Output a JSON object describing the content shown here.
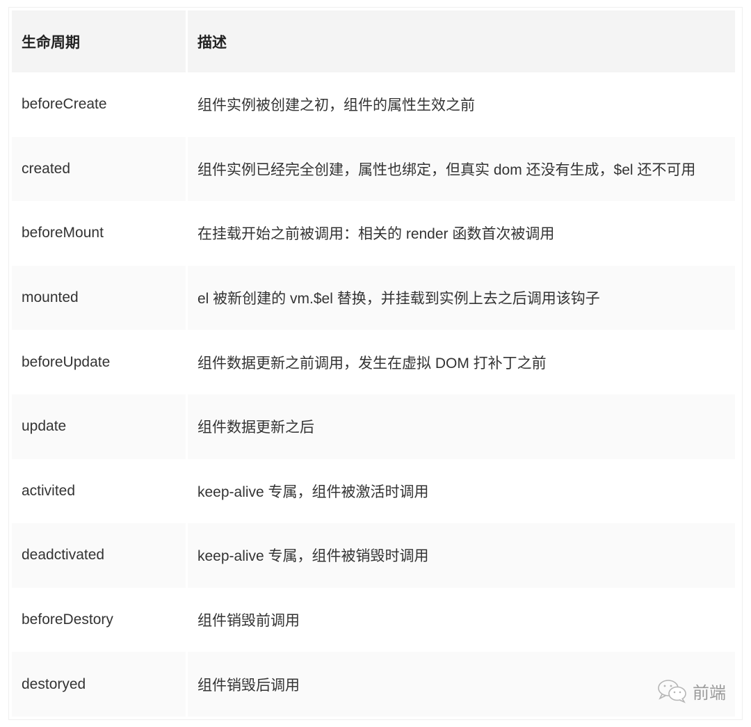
{
  "table": {
    "headers": {
      "lifecycle": "生命周期",
      "description": "描述"
    },
    "rows": [
      {
        "name": "beforeCreate",
        "description": "组件实例被创建之初，组件的属性生效之前"
      },
      {
        "name": "created",
        "description": "组件实例已经完全创建，属性也绑定，但真实 dom 还没有生成，$el 还不可用"
      },
      {
        "name": "beforeMount",
        "description": "在挂载开始之前被调用：相关的 render 函数首次被调用"
      },
      {
        "name": "mounted",
        "description": "el 被新创建的 vm.$el 替换，并挂载到实例上去之后调用该钩子"
      },
      {
        "name": "beforeUpdate",
        "description": "组件数据更新之前调用，发生在虚拟 DOM 打补丁之前"
      },
      {
        "name": "update",
        "description": "组件数据更新之后"
      },
      {
        "name": "activited",
        "description": "keep-alive 专属，组件被激活时调用"
      },
      {
        "name": "deadctivated",
        "description": "keep-alive 专属，组件被销毁时调用"
      },
      {
        "name": "beforeDestory",
        "description": "组件销毁前调用"
      },
      {
        "name": "destoryed",
        "description": "组件销毁后调用"
      }
    ]
  },
  "watermark": {
    "icon": "wechat-icon",
    "text": "前端"
  }
}
